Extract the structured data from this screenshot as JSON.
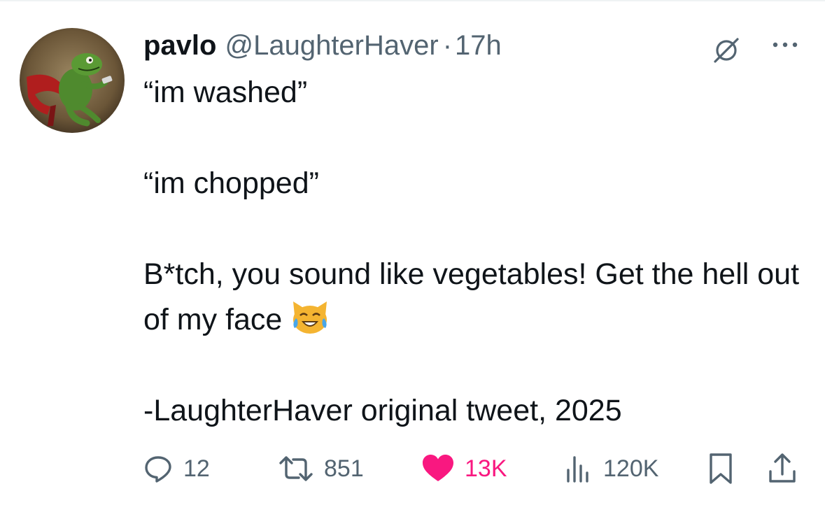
{
  "tweet": {
    "author": {
      "display_name": "pavlo",
      "handle": "@LaughterHaver",
      "separator": "·",
      "time": "17h",
      "avatar_icon": "kermit-avatar"
    },
    "header_icons": [
      "grok-icon",
      "more-options-icon"
    ],
    "body": {
      "line1": "“im washed”",
      "line2": "“im chopped”",
      "line3": "B*tch, you sound like vegetables! Get the hell out of my face",
      "emoji": "cat-tears-of-joy-emoji",
      "line4": "-LaughterHaver original tweet, 2025"
    },
    "actions": {
      "replies": "12",
      "reposts": "851",
      "likes": "13K",
      "views": "120K",
      "bookmark_icon": "bookmark-icon",
      "share_icon": "share-icon"
    },
    "colors": {
      "text": "#0f1419",
      "secondary": "#536471",
      "like": "#f91880"
    }
  }
}
